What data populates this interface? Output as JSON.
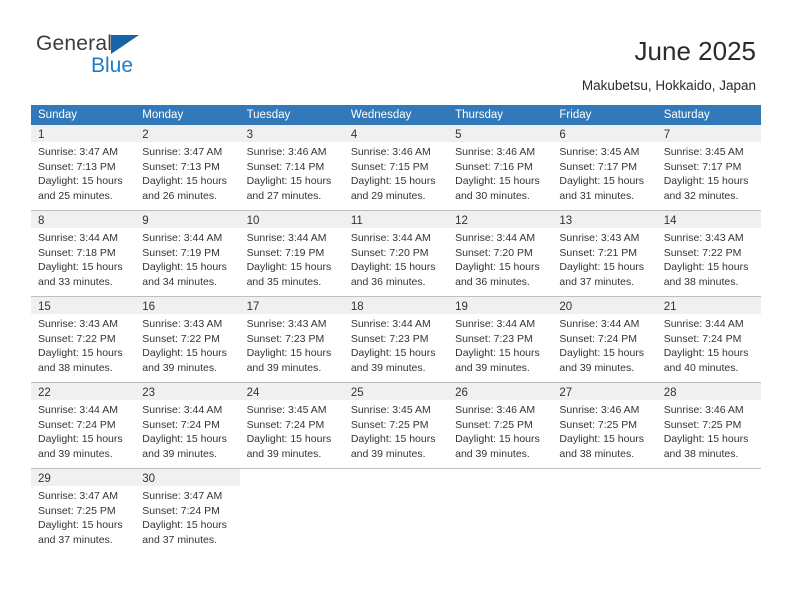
{
  "brand": {
    "name_primary": "General",
    "name_secondary": "Blue",
    "triangle_color": "#1763a6",
    "secondary_color": "#1f7cc6"
  },
  "header": {
    "title": "June 2025",
    "subtitle": "Makubetsu, Hokkaido, Japan"
  },
  "theme": {
    "header_bg": "#3179b9",
    "header_text": "#ffffff",
    "daynum_bg": "#f0f0f0",
    "grid_line": "#bfbfbf",
    "body_text": "#343434"
  },
  "calendar": {
    "weekday_headers": [
      "Sunday",
      "Monday",
      "Tuesday",
      "Wednesday",
      "Thursday",
      "Friday",
      "Saturday"
    ],
    "weeks": [
      [
        {
          "day": "1",
          "sunrise": "Sunrise: 3:47 AM",
          "sunset": "Sunset: 7:13 PM",
          "daylight_line1": "Daylight: 15 hours",
          "daylight_line2": "and 25 minutes."
        },
        {
          "day": "2",
          "sunrise": "Sunrise: 3:47 AM",
          "sunset": "Sunset: 7:13 PM",
          "daylight_line1": "Daylight: 15 hours",
          "daylight_line2": "and 26 minutes."
        },
        {
          "day": "3",
          "sunrise": "Sunrise: 3:46 AM",
          "sunset": "Sunset: 7:14 PM",
          "daylight_line1": "Daylight: 15 hours",
          "daylight_line2": "and 27 minutes."
        },
        {
          "day": "4",
          "sunrise": "Sunrise: 3:46 AM",
          "sunset": "Sunset: 7:15 PM",
          "daylight_line1": "Daylight: 15 hours",
          "daylight_line2": "and 29 minutes."
        },
        {
          "day": "5",
          "sunrise": "Sunrise: 3:46 AM",
          "sunset": "Sunset: 7:16 PM",
          "daylight_line1": "Daylight: 15 hours",
          "daylight_line2": "and 30 minutes."
        },
        {
          "day": "6",
          "sunrise": "Sunrise: 3:45 AM",
          "sunset": "Sunset: 7:17 PM",
          "daylight_line1": "Daylight: 15 hours",
          "daylight_line2": "and 31 minutes."
        },
        {
          "day": "7",
          "sunrise": "Sunrise: 3:45 AM",
          "sunset": "Sunset: 7:17 PM",
          "daylight_line1": "Daylight: 15 hours",
          "daylight_line2": "and 32 minutes."
        }
      ],
      [
        {
          "day": "8",
          "sunrise": "Sunrise: 3:44 AM",
          "sunset": "Sunset: 7:18 PM",
          "daylight_line1": "Daylight: 15 hours",
          "daylight_line2": "and 33 minutes."
        },
        {
          "day": "9",
          "sunrise": "Sunrise: 3:44 AM",
          "sunset": "Sunset: 7:19 PM",
          "daylight_line1": "Daylight: 15 hours",
          "daylight_line2": "and 34 minutes."
        },
        {
          "day": "10",
          "sunrise": "Sunrise: 3:44 AM",
          "sunset": "Sunset: 7:19 PM",
          "daylight_line1": "Daylight: 15 hours",
          "daylight_line2": "and 35 minutes."
        },
        {
          "day": "11",
          "sunrise": "Sunrise: 3:44 AM",
          "sunset": "Sunset: 7:20 PM",
          "daylight_line1": "Daylight: 15 hours",
          "daylight_line2": "and 36 minutes."
        },
        {
          "day": "12",
          "sunrise": "Sunrise: 3:44 AM",
          "sunset": "Sunset: 7:20 PM",
          "daylight_line1": "Daylight: 15 hours",
          "daylight_line2": "and 36 minutes."
        },
        {
          "day": "13",
          "sunrise": "Sunrise: 3:43 AM",
          "sunset": "Sunset: 7:21 PM",
          "daylight_line1": "Daylight: 15 hours",
          "daylight_line2": "and 37 minutes."
        },
        {
          "day": "14",
          "sunrise": "Sunrise: 3:43 AM",
          "sunset": "Sunset: 7:22 PM",
          "daylight_line1": "Daylight: 15 hours",
          "daylight_line2": "and 38 minutes."
        }
      ],
      [
        {
          "day": "15",
          "sunrise": "Sunrise: 3:43 AM",
          "sunset": "Sunset: 7:22 PM",
          "daylight_line1": "Daylight: 15 hours",
          "daylight_line2": "and 38 minutes."
        },
        {
          "day": "16",
          "sunrise": "Sunrise: 3:43 AM",
          "sunset": "Sunset: 7:22 PM",
          "daylight_line1": "Daylight: 15 hours",
          "daylight_line2": "and 39 minutes."
        },
        {
          "day": "17",
          "sunrise": "Sunrise: 3:43 AM",
          "sunset": "Sunset: 7:23 PM",
          "daylight_line1": "Daylight: 15 hours",
          "daylight_line2": "and 39 minutes."
        },
        {
          "day": "18",
          "sunrise": "Sunrise: 3:44 AM",
          "sunset": "Sunset: 7:23 PM",
          "daylight_line1": "Daylight: 15 hours",
          "daylight_line2": "and 39 minutes."
        },
        {
          "day": "19",
          "sunrise": "Sunrise: 3:44 AM",
          "sunset": "Sunset: 7:23 PM",
          "daylight_line1": "Daylight: 15 hours",
          "daylight_line2": "and 39 minutes."
        },
        {
          "day": "20",
          "sunrise": "Sunrise: 3:44 AM",
          "sunset": "Sunset: 7:24 PM",
          "daylight_line1": "Daylight: 15 hours",
          "daylight_line2": "and 39 minutes."
        },
        {
          "day": "21",
          "sunrise": "Sunrise: 3:44 AM",
          "sunset": "Sunset: 7:24 PM",
          "daylight_line1": "Daylight: 15 hours",
          "daylight_line2": "and 40 minutes."
        }
      ],
      [
        {
          "day": "22",
          "sunrise": "Sunrise: 3:44 AM",
          "sunset": "Sunset: 7:24 PM",
          "daylight_line1": "Daylight: 15 hours",
          "daylight_line2": "and 39 minutes."
        },
        {
          "day": "23",
          "sunrise": "Sunrise: 3:44 AM",
          "sunset": "Sunset: 7:24 PM",
          "daylight_line1": "Daylight: 15 hours",
          "daylight_line2": "and 39 minutes."
        },
        {
          "day": "24",
          "sunrise": "Sunrise: 3:45 AM",
          "sunset": "Sunset: 7:24 PM",
          "daylight_line1": "Daylight: 15 hours",
          "daylight_line2": "and 39 minutes."
        },
        {
          "day": "25",
          "sunrise": "Sunrise: 3:45 AM",
          "sunset": "Sunset: 7:25 PM",
          "daylight_line1": "Daylight: 15 hours",
          "daylight_line2": "and 39 minutes."
        },
        {
          "day": "26",
          "sunrise": "Sunrise: 3:46 AM",
          "sunset": "Sunset: 7:25 PM",
          "daylight_line1": "Daylight: 15 hours",
          "daylight_line2": "and 39 minutes."
        },
        {
          "day": "27",
          "sunrise": "Sunrise: 3:46 AM",
          "sunset": "Sunset: 7:25 PM",
          "daylight_line1": "Daylight: 15 hours",
          "daylight_line2": "and 38 minutes."
        },
        {
          "day": "28",
          "sunrise": "Sunrise: 3:46 AM",
          "sunset": "Sunset: 7:25 PM",
          "daylight_line1": "Daylight: 15 hours",
          "daylight_line2": "and 38 minutes."
        }
      ],
      [
        {
          "day": "29",
          "sunrise": "Sunrise: 3:47 AM",
          "sunset": "Sunset: 7:25 PM",
          "daylight_line1": "Daylight: 15 hours",
          "daylight_line2": "and 37 minutes."
        },
        {
          "day": "30",
          "sunrise": "Sunrise: 3:47 AM",
          "sunset": "Sunset: 7:24 PM",
          "daylight_line1": "Daylight: 15 hours",
          "daylight_line2": "and 37 minutes."
        },
        {
          "day": "",
          "sunrise": "",
          "sunset": "",
          "daylight_line1": "",
          "daylight_line2": ""
        },
        {
          "day": "",
          "sunrise": "",
          "sunset": "",
          "daylight_line1": "",
          "daylight_line2": ""
        },
        {
          "day": "",
          "sunrise": "",
          "sunset": "",
          "daylight_line1": "",
          "daylight_line2": ""
        },
        {
          "day": "",
          "sunrise": "",
          "sunset": "",
          "daylight_line1": "",
          "daylight_line2": ""
        },
        {
          "day": "",
          "sunrise": "",
          "sunset": "",
          "daylight_line1": "",
          "daylight_line2": ""
        }
      ]
    ]
  }
}
